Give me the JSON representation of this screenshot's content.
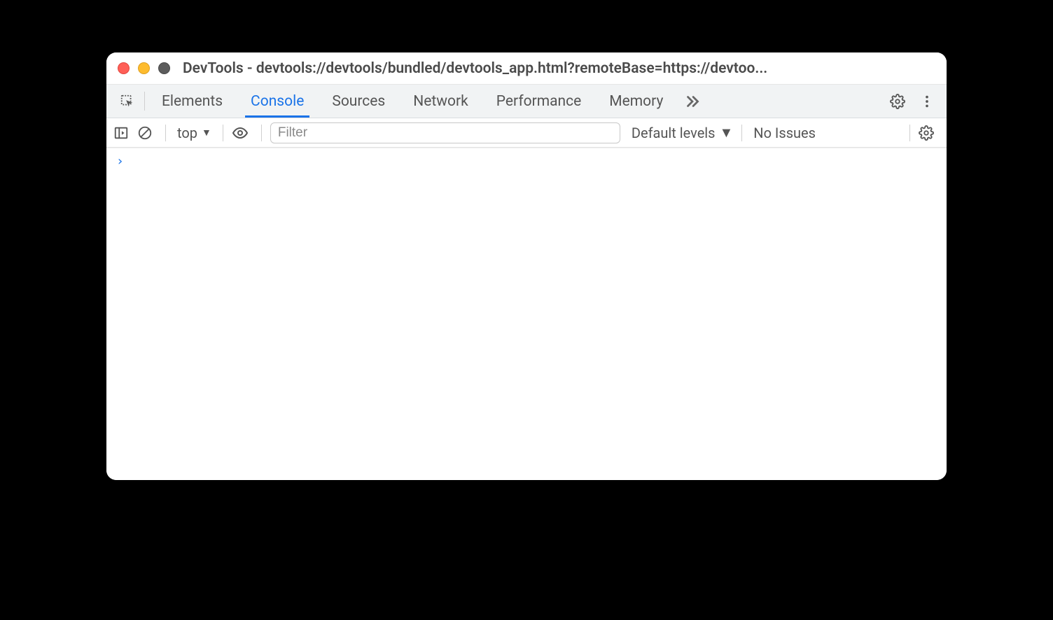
{
  "window": {
    "title": "DevTools - devtools://devtools/bundled/devtools_app.html?remoteBase=https://devtoo..."
  },
  "tabs": {
    "items": [
      {
        "label": "Elements",
        "active": false
      },
      {
        "label": "Console",
        "active": true
      },
      {
        "label": "Sources",
        "active": false
      },
      {
        "label": "Network",
        "active": false
      },
      {
        "label": "Performance",
        "active": false
      },
      {
        "label": "Memory",
        "active": false
      }
    ]
  },
  "console_toolbar": {
    "context": "top",
    "filter_placeholder": "Filter",
    "levels_label": "Default levels",
    "issues_label": "No Issues"
  },
  "console": {
    "prompt": "›"
  }
}
